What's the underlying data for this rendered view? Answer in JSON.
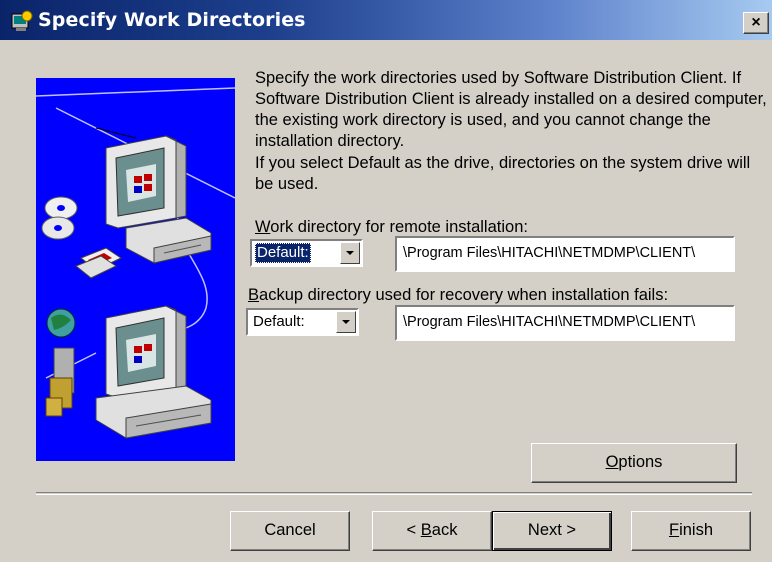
{
  "window": {
    "title": "Specify Work Directories",
    "close_label": "×"
  },
  "description": {
    "paragraph1": "Specify the work directories used by Software Distribution Client. If Software Distribution Client is already installed on a desired computer, the existing work directory is used, and you cannot change the installation directory.",
    "paragraph2": "If you select Default as the drive, directories on the system drive will be used."
  },
  "remote_install": {
    "label_mnemonic": "W",
    "label_rest": "ork directory for remote installation:",
    "drive": "Default:",
    "path": "\\Program Files\\HITACHI\\NETMDMP\\CLIENT\\"
  },
  "backup": {
    "label_mnemonic": "B",
    "label_rest": "ackup directory used for recovery when installation fails:",
    "drive": "Default:",
    "path": "\\Program Files\\HITACHI\\NETMDMP\\CLIENT\\"
  },
  "buttons": {
    "options_mnemonic": "O",
    "options_rest": "ptions",
    "cancel": "Cancel",
    "back_prefix": "< ",
    "back_mnemonic": "B",
    "back_rest": "ack",
    "next": "Next >",
    "finish_mnemonic": "F",
    "finish_rest": "inish"
  },
  "colors": {
    "titlebar_start": "#0a246a",
    "titlebar_end": "#a6caf0",
    "dialog_bg": "#d4d0c8",
    "art_bg": "#0000ff",
    "selection": "#0a246a"
  },
  "icons": [
    "setup-app-icon",
    "close-icon",
    "dropdown-arrow-icon",
    "computer-icon",
    "cd-icon",
    "floppy-icon",
    "globe-icon"
  ]
}
